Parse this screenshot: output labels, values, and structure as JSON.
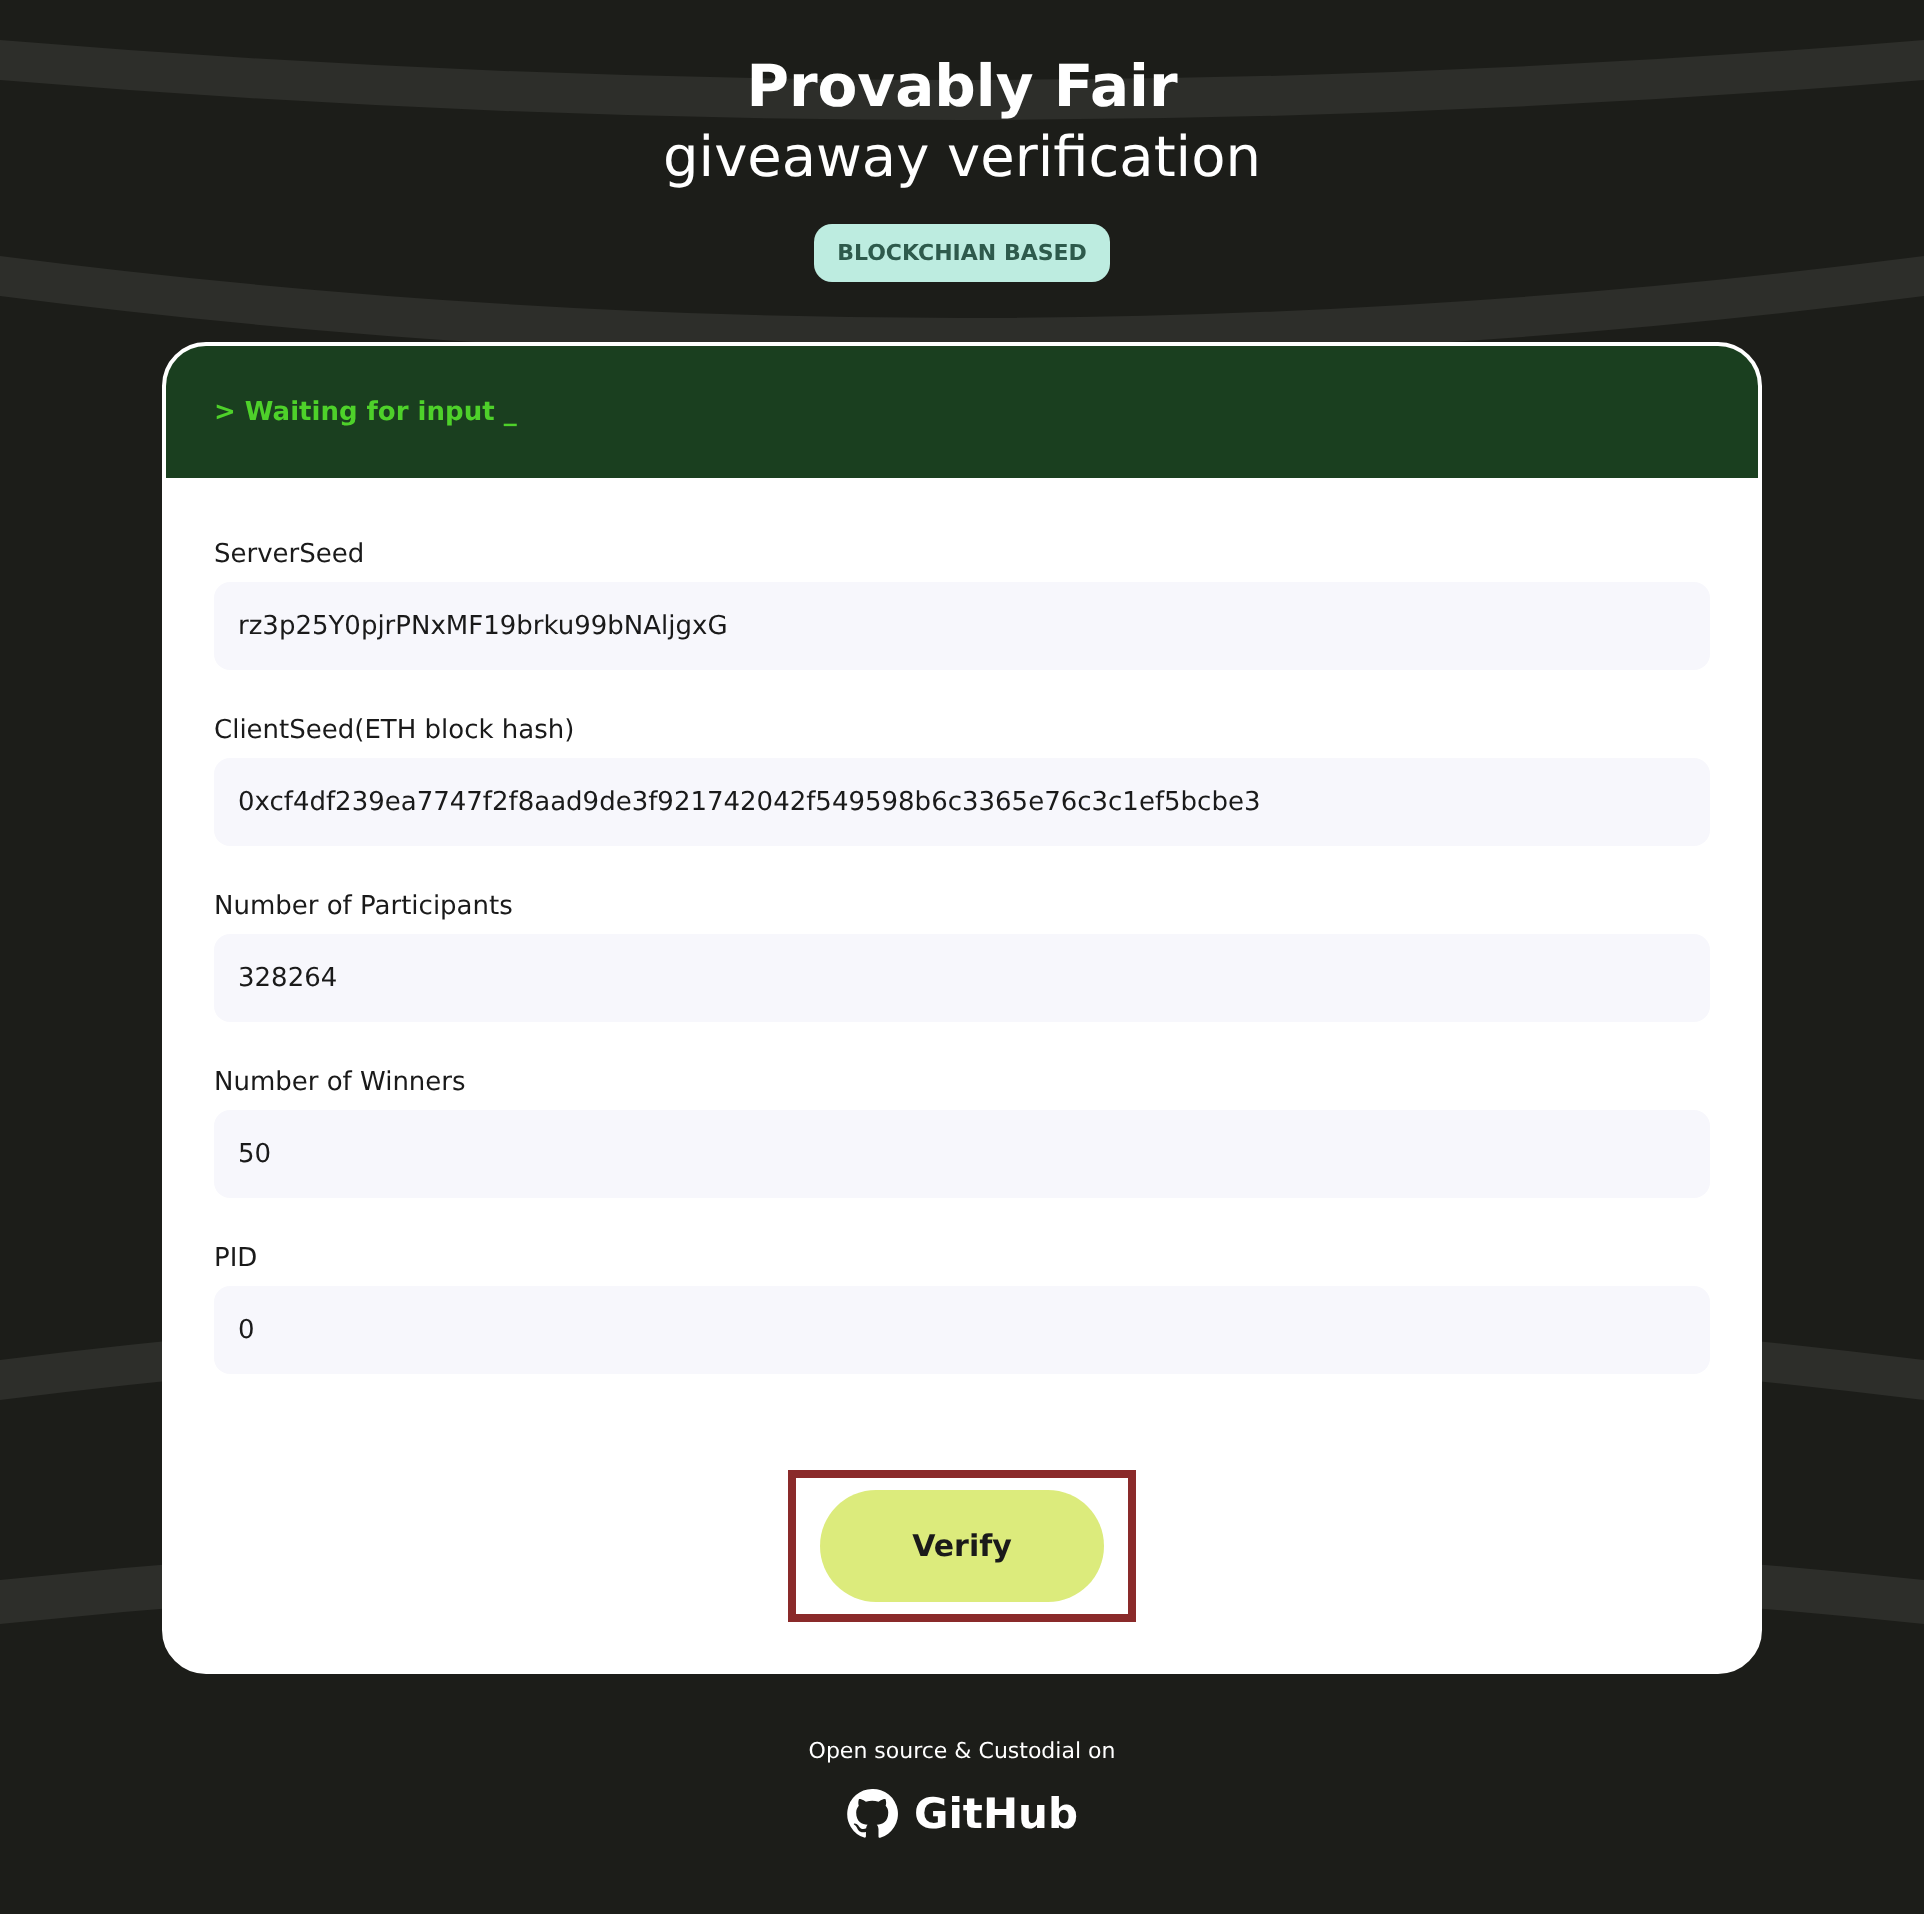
{
  "header": {
    "title": "Provably Fair",
    "subtitle": "giveaway verification",
    "badge": "BLOCKCHIAN BASED"
  },
  "console": {
    "status": "> Waiting for input _"
  },
  "fields": [
    {
      "label": "ServerSeed",
      "value": "rz3p25Y0pjrPNxMF19brku99bNAljgxG"
    },
    {
      "label": "ClientSeed(ETH block hash)",
      "value": "0xcf4df239ea7747f2f8aad9de3f921742042f549598b6c3365e76c3c1ef5bcbe3"
    },
    {
      "label": "Number of Participants",
      "value": "328264"
    },
    {
      "label": "Number of Winners",
      "value": "50"
    },
    {
      "label": "PID",
      "value": "0"
    }
  ],
  "verify_button": {
    "label": "Verify",
    "highlighted": true
  },
  "footer": {
    "note": "Open source & Custodial on",
    "link": "GitHub"
  }
}
